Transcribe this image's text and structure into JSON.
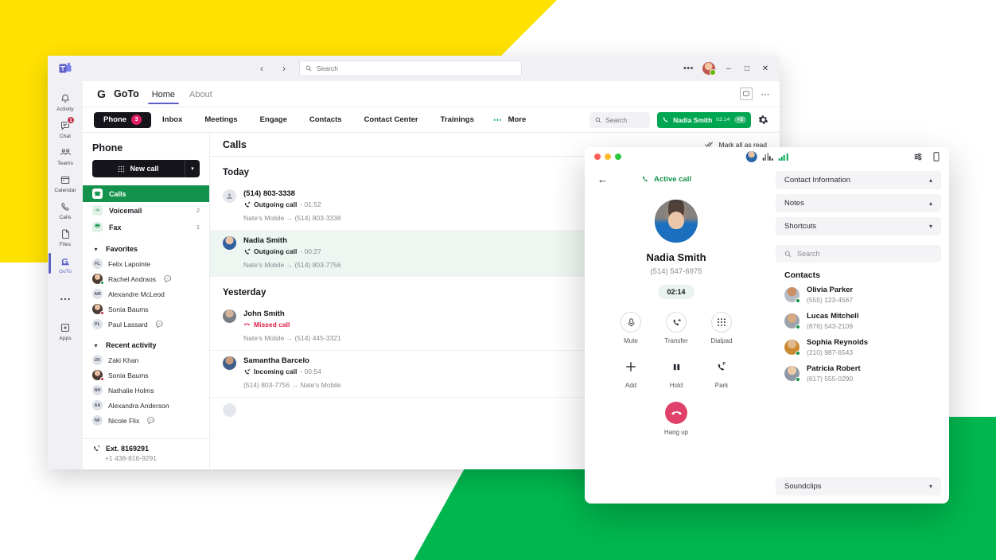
{
  "teams_window": {
    "titlebar": {
      "back_icon": "chevron-left-icon",
      "forward_icon": "chevron-right-icon",
      "search_placeholder": "Search",
      "more_label": "•••",
      "minimize_label": "–",
      "maximize_label": "□",
      "close_label": "✕"
    },
    "rail": [
      {
        "label": "Activity",
        "icon": "bell-icon",
        "badge": "",
        "active": false
      },
      {
        "label": "Chat",
        "icon": "chat-icon",
        "badge": "1",
        "active": false
      },
      {
        "label": "Teams",
        "icon": "teams-icon",
        "badge": "",
        "active": false
      },
      {
        "label": "Calendar",
        "icon": "calendar-icon",
        "badge": "",
        "active": false
      },
      {
        "label": "Calls",
        "icon": "phone-icon",
        "badge": "",
        "active": false
      },
      {
        "label": "Files",
        "icon": "file-icon",
        "badge": "",
        "active": false
      },
      {
        "label": "GoTo",
        "icon": "goto-icon",
        "badge": "",
        "active": true
      },
      {
        "label": "",
        "icon": "more-dots-icon",
        "badge": "",
        "active": false
      },
      {
        "label": "Apps",
        "icon": "plus-box-icon",
        "badge": "",
        "active": false
      }
    ],
    "goto_header": {
      "logo_letter": "G",
      "app_name": "GoTo",
      "tabs": [
        {
          "label": "Home",
          "selected": true
        },
        {
          "label": "About",
          "selected": false
        }
      ],
      "right_icons": [
        "screen-icon",
        "overflow-dots-icon"
      ]
    },
    "product_tabs": {
      "items": [
        {
          "label": "Phone",
          "badge": "3",
          "active": true
        },
        {
          "label": "Inbox",
          "badge": "",
          "active": false
        },
        {
          "label": "Meetings",
          "badge": "",
          "active": false
        },
        {
          "label": "Engage",
          "badge": "",
          "active": false
        },
        {
          "label": "Contacts",
          "badge": "",
          "active": false
        },
        {
          "label": "Contact Center",
          "badge": "",
          "active": false
        },
        {
          "label": "Trainings",
          "badge": "",
          "active": false
        }
      ],
      "more_label": "More",
      "search_placeholder": "Search",
      "active_call_pill": {
        "name": "Nadia Smith",
        "timer": "02:14",
        "extra": "+5"
      },
      "settings_icon": "gear-icon"
    }
  },
  "phone_pane": {
    "title": "Phone",
    "new_call_label": "New call",
    "new_call_caret": "chevron-down-icon",
    "nav": [
      {
        "label": "Calls",
        "icon": "phone-filled-icon",
        "count": "",
        "selected": true
      },
      {
        "label": "Voicemail",
        "icon": "voicemail-icon",
        "count": "2",
        "selected": false
      },
      {
        "label": "Fax",
        "icon": "fax-icon",
        "count": "1",
        "selected": false
      }
    ],
    "favorites": {
      "title": "Favorites",
      "items": [
        {
          "name": "Felix Lapointe",
          "initials": "FL",
          "presence": "none",
          "photo": false,
          "chat": false
        },
        {
          "name": "Rachel Andraos",
          "initials": "RA",
          "presence": "online",
          "photo": true,
          "chat": true
        },
        {
          "name": "Alexandre McLeod",
          "initials": "AM",
          "presence": "online",
          "photo": false,
          "chat": false
        },
        {
          "name": "Sonia Baums",
          "initials": "SB",
          "presence": "busy",
          "photo": true,
          "chat": false
        },
        {
          "name": "Paul Lassard",
          "initials": "PL",
          "presence": "away",
          "photo": false,
          "chat": true
        }
      ]
    },
    "recent_activity": {
      "title": "Recent activity",
      "items": [
        {
          "name": "Zaki Khan",
          "initials": "ZK",
          "presence": "none",
          "photo": false,
          "chat": false
        },
        {
          "name": "Sonia Baums",
          "initials": "SB",
          "presence": "busy",
          "photo": true,
          "chat": false
        },
        {
          "name": "Nathalie Holms",
          "initials": "NH",
          "presence": "none",
          "photo": false,
          "chat": false
        },
        {
          "name": "Alexandra Anderson",
          "initials": "AA",
          "presence": "none",
          "photo": false,
          "chat": false
        },
        {
          "name": "Nicole Flix",
          "initials": "NF",
          "presence": "away",
          "photo": false,
          "chat": true
        }
      ]
    },
    "extension": {
      "label": "Ext. 8169291",
      "number": "+1 438-816-9291",
      "icon": "phone-transfer-icon"
    }
  },
  "calls_view": {
    "header": "Calls",
    "mark_all_read": "Mark all as read",
    "groups": [
      {
        "day": "Today",
        "calls": [
          {
            "name": "(514) 803-3338",
            "type": "Outgoing call",
            "duration": "01:52",
            "from": "Nate's Mobile",
            "to": "(514) 803-3338",
            "avatar": "generic",
            "missed": false,
            "active": false
          },
          {
            "name": "Nadia Smith",
            "type": "Outgoing call",
            "duration": "00:27",
            "from": "Nate's Mobile",
            "to": "(514) 803-7756",
            "avatar": "p1",
            "missed": false,
            "active": true
          }
        ]
      },
      {
        "day": "Yesterday",
        "calls": [
          {
            "name": "John Smith",
            "type": "Missed call",
            "duration": "",
            "from": "Nate's Mobile",
            "to": "(514) 445-3321",
            "avatar": "p2",
            "missed": true,
            "active": false
          },
          {
            "name": "Samantha Barcelo",
            "type": "Incoming call",
            "duration": "00:54",
            "from": "(514) 803-7756",
            "to": "Nate's Mobile",
            "avatar": "p3",
            "missed": false,
            "active": false
          }
        ]
      }
    ]
  },
  "call_window": {
    "titlebar": {
      "traffic_lights": [
        "close-dot",
        "minimize-dot",
        "zoom-dot"
      ],
      "avatar_icon": "caller-avatar",
      "waveform_icon": "audio-waveform-icon",
      "signal_icon": "signal-bars-icon",
      "settings_icon": "sliders-icon",
      "device_icon": "mobile-icon"
    },
    "back_icon": "arrow-left-icon",
    "status_label": "Active call",
    "status_icon": "phone-icon",
    "caller_name": "Nadia Smith",
    "caller_number": "(514) 547-6975",
    "timer": "02:14",
    "controls": [
      {
        "label": "Mute",
        "icon": "microphone-icon",
        "circled": true
      },
      {
        "label": "Transfer",
        "icon": "call-transfer-icon",
        "circled": true
      },
      {
        "label": "Dialpad",
        "icon": "dialpad-icon",
        "circled": true
      },
      {
        "label": "Add",
        "icon": "plus-icon",
        "circled": false
      },
      {
        "label": "Hold",
        "icon": "pause-icon",
        "circled": false
      },
      {
        "label": "Park",
        "icon": "call-park-icon",
        "circled": false
      }
    ],
    "hangup": {
      "label": "Hang up",
      "icon": "hangup-icon",
      "color": "#E0416A"
    },
    "panel": {
      "sections": [
        {
          "label": "Contact Information",
          "expanded": true
        },
        {
          "label": "Notes",
          "expanded": true
        },
        {
          "label": "Shortcuts",
          "expanded": false
        }
      ],
      "search_placeholder": "Search",
      "contacts_label": "Contacts",
      "contacts": [
        {
          "name": "Olivia Parker",
          "number": "(555) 123-4567",
          "presence": "online",
          "avatar": "cc-a1"
        },
        {
          "name": "Lucas Mitchell",
          "number": "(876) 543-2109",
          "presence": "online",
          "avatar": "cc-a2"
        },
        {
          "name": "Sophia Reynolds",
          "number": "(210) 987-6543",
          "presence": "online",
          "avatar": "cc-a3"
        },
        {
          "name": "Patricia Robert",
          "number": "(617) 555-0290",
          "presence": "online",
          "avatar": "cc-a4"
        }
      ],
      "soundclips": {
        "label": "Soundclips",
        "expanded": false
      }
    }
  },
  "theme": {
    "brand_green": "#00A651",
    "dark_green": "#13924B",
    "yellow": "#FFE200",
    "accent_purple": "#5B5FC7",
    "danger_red": "#E11D48",
    "badge_pink": "#E11D62"
  }
}
